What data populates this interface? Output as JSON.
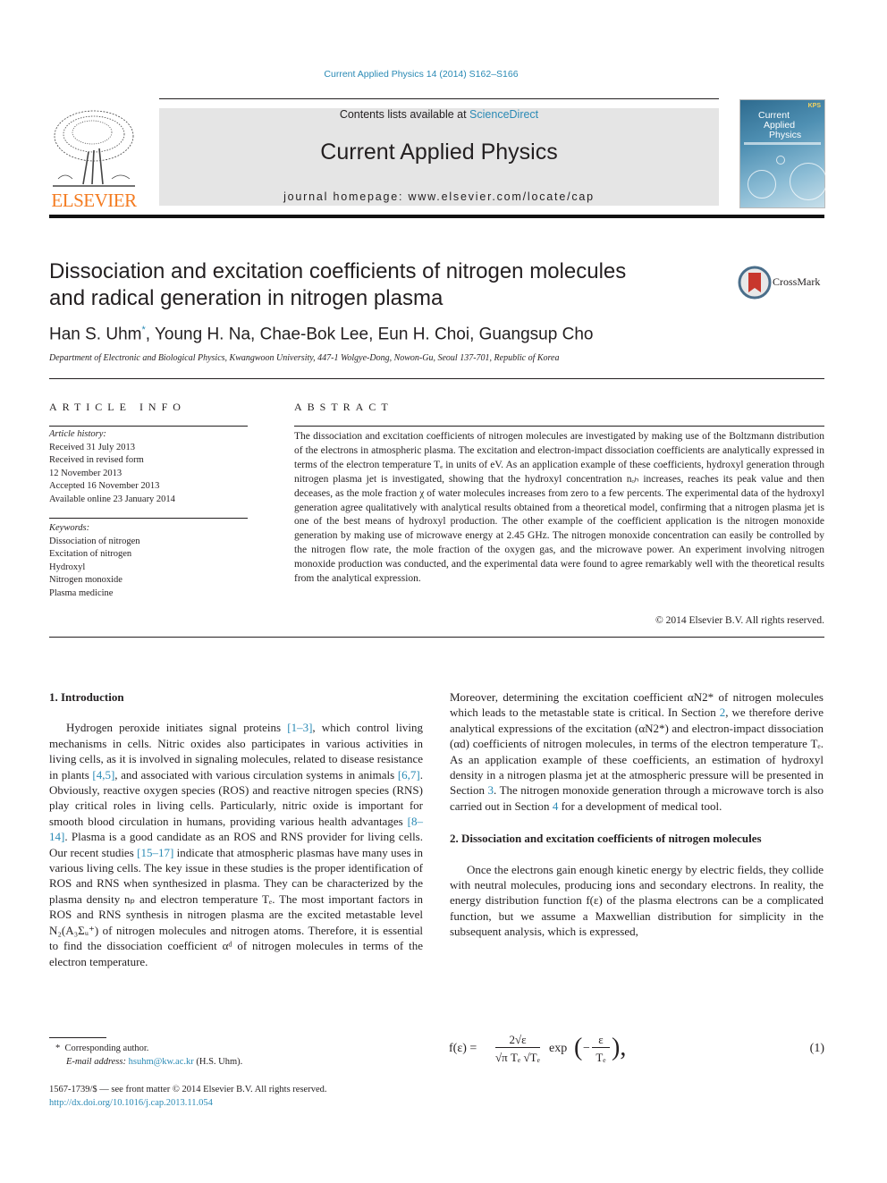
{
  "citation": "Current Applied Physics 14 (2014) S162–S166",
  "header": {
    "contents_prefix": "Contents lists available at ",
    "contents_link": "ScienceDirect",
    "journal_title": "Current Applied Physics",
    "homepage": "journal homepage: www.elsevier.com/locate/cap",
    "publisher_logo": "ELSEVIER",
    "cover": {
      "line1": "Current",
      "line2": "Applied",
      "line3": "Physics",
      "badge": "KPS"
    }
  },
  "colors": {
    "link": "#2a8ab5",
    "elsevier_orange": "#f47b20",
    "band_gray": "#e5e5e5"
  },
  "article": {
    "title_line1": "Dissociation and excitation coefficients of nitrogen molecules",
    "title_line2": "and radical generation in nitrogen plasma",
    "crossmark": "CrossMark",
    "authors": [
      {
        "name": "Han S. Uhm",
        "mark": "*"
      },
      {
        "name": "Young H. Na"
      },
      {
        "name": "Chae-Bok Lee"
      },
      {
        "name": "Eun H. Choi"
      },
      {
        "name": "Guangsup Cho"
      }
    ],
    "affiliation": "Department of Electronic and Biological Physics, Kwangwoon University, 447-1 Wolgye-Dong, Nowon-Gu, Seoul 137-701, Republic of Korea"
  },
  "article_info": {
    "heading": "ARTICLE INFO",
    "history_label": "Article history:",
    "history": [
      "Received 31 July 2013",
      "Received in revised form",
      "12 November 2013",
      "Accepted 16 November 2013",
      "Available online 23 January 2014"
    ],
    "keywords_label": "Keywords:",
    "keywords": [
      "Dissociation of nitrogen",
      "Excitation of nitrogen",
      "Hydroxyl",
      "Nitrogen monoxide",
      "Plasma medicine"
    ]
  },
  "abstract": {
    "heading": "ABSTRACT",
    "text": "The dissociation and excitation coefficients of nitrogen molecules are investigated by making use of the Boltzmann distribution of the electrons in atmospheric plasma. The excitation and electron-impact dissociation coefficients are analytically expressed in terms of the electron temperature Tₑ in units of eV. As an application example of these coefficients, hydroxyl generation through nitrogen plasma jet is investigated, showing that the hydroxyl concentration nₒₕ increases, reaches its peak value and then deceases, as the mole fraction χ of water molecules increases from zero to a few percents. The experimental data of the hydroxyl generation agree qualitatively with analytical results obtained from a theoretical model, confirming that a nitrogen plasma jet is one of the best means of hydroxyl production. The other example of the coefficient application is the nitrogen monoxide generation by making use of microwave energy at 2.45 GHz. The nitrogen monoxide concentration can easily be controlled by the nitrogen flow rate, the mole fraction of the oxygen gas, and the microwave power. An experiment involving nitrogen monoxide production was conducted, and the experimental data were found to agree remarkably well with the theoretical results from the analytical expression.",
    "copyright": "© 2014 Elsevier B.V. All rights reserved."
  },
  "intro": {
    "heading": "1.  Introduction",
    "p1_a": "Hydrogen peroxide initiates signal proteins ",
    "ref1": "[1–3]",
    "p1_b": ", which control living mechanisms in cells. Nitric oxides also participates in various activities in living cells, as it is involved in signaling molecules, related to disease resistance in plants ",
    "ref2": "[4,5]",
    "p1_c": ", and associated with various circulation systems in animals ",
    "ref3": "[6,7]",
    "p1_d": ". Obviously, reactive oxygen species (ROS) and reactive nitrogen species (RNS) play critical roles in living cells. Particularly, nitric oxide is important for smooth blood circulation in humans, providing various health advantages ",
    "ref4": "[8–14]",
    "p1_e": ". Plasma is a good candidate as an ROS and RNS provider for living cells. Our recent studies ",
    "ref5": "[15–17]",
    "p1_f": " indicate that atmospheric plasmas have many uses in various living cells. The key issue in these studies is the proper identification of ROS and RNS when synthesized in plasma. They can be characterized by the plasma density nₚ and electron temperature Tₑ. The most important factors in ROS and RNS synthesis in nitrogen plasma are the excited metastable level N₂(A₃Σᵤ⁺) of nitrogen molecules and nitrogen atoms. Therefore, it is essential to find the dissociation coefficient αᵈ of nitrogen molecules in terms of the electron temperature.",
    "p2_a": "Moreover, determining the excitation coefficient αN2* of nitrogen molecules which leads to the metastable state is critical. In Section ",
    "sec2": "2",
    "p2_b": ", we therefore derive analytical expressions of the excitation (αN2*) and electron-impact dissociation (αd) coefficients of nitrogen molecules, in terms of the electron temperature Tₑ. As an application example of these coefficients, an estimation of hydroxyl density in a nitrogen plasma jet at the atmospheric pressure will be presented in Section ",
    "sec3": "3",
    "p2_c": ". The nitrogen monoxide generation through a microwave torch is also carried out in Section ",
    "sec4": "4",
    "p2_d": " for a development of medical tool."
  },
  "section2": {
    "heading": "2.  Dissociation and excitation coefficients of nitrogen molecules",
    "p1": "Once the electrons gain enough kinetic energy by electric fields, they collide with neutral molecules, producing ions and secondary electrons. In reality, the energy distribution function f(ε) of the plasma electrons can be a complicated function, but we assume a Maxwellian distribution for simplicity in the subsequent analysis, which is expressed,",
    "equation_lhs": "f(ε) =",
    "equation_num": "(1)",
    "equation_numerator": "2√ε",
    "equation_denominator": "√π Tₑ √Tₑ",
    "equation_exp": "exp",
    "equation_inner_num": "ε",
    "equation_inner_den": "Tₑ"
  },
  "footnotes": {
    "star": "*",
    "corresponding": "Corresponding author.",
    "email_label": "E-mail address: ",
    "email": "hsuhm@kw.ac.kr",
    "email_suffix": " (H.S. Uhm).",
    "issn": "1567-1739/$ — see front matter © 2014 Elsevier B.V. All rights reserved.",
    "doi": "http://dx.doi.org/10.1016/j.cap.2013.11.054"
  }
}
